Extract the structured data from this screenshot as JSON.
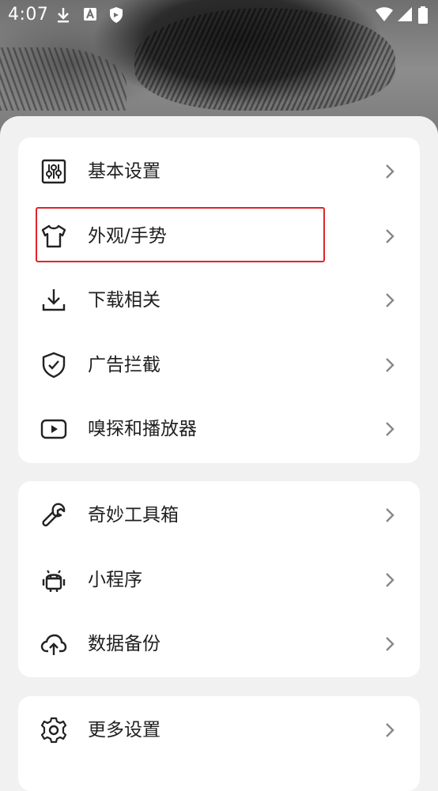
{
  "status_bar": {
    "time": "4:07",
    "icons": [
      "download-icon",
      "font-icon",
      "shield-icon"
    ],
    "right_icons": [
      "wifi-icon",
      "signal-icon",
      "battery-icon"
    ]
  },
  "groups": [
    {
      "items": [
        {
          "label": "基本设置",
          "icon": "sliders-icon"
        },
        {
          "label": "外观/手势",
          "icon": "tshirt-icon",
          "highlighted": true
        },
        {
          "label": "下载相关",
          "icon": "download-icon"
        },
        {
          "label": "广告拦截",
          "icon": "shield-check-icon"
        },
        {
          "label": "嗅探和播放器",
          "icon": "youtube-icon"
        }
      ]
    },
    {
      "items": [
        {
          "label": "奇妙工具箱",
          "icon": "wrench-icon"
        },
        {
          "label": "小程序",
          "icon": "android-icon"
        },
        {
          "label": "数据备份",
          "icon": "cloud-upload-icon"
        }
      ]
    },
    {
      "items": [
        {
          "label": "更多设置",
          "icon": "gear-icon"
        }
      ]
    }
  ],
  "colors": {
    "highlight_border": "#e0232b",
    "sheet_background": "#f1f1f1",
    "card_background": "#ffffff"
  }
}
